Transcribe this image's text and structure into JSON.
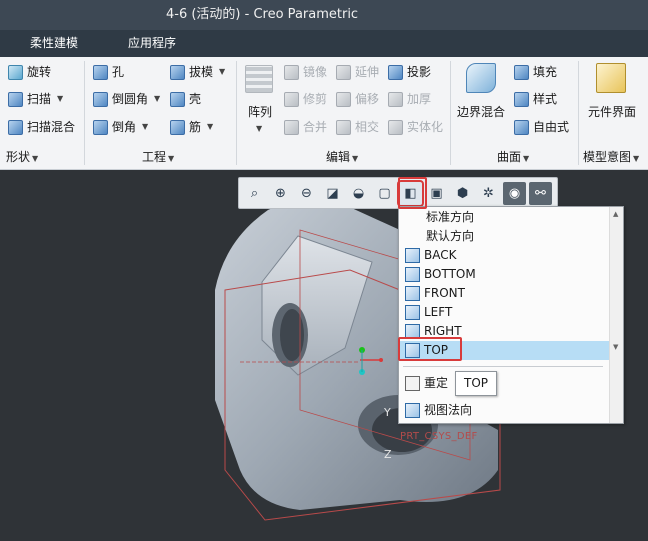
{
  "window": {
    "title": "4-6 (活动的) - Creo Parametric"
  },
  "menu": {
    "tabs": [
      "柔性建模",
      "应用程序"
    ]
  },
  "ribbon": {
    "shape": {
      "items": [
        "旋转",
        "扫描",
        "扫描混合"
      ],
      "label": "形状"
    },
    "engineering": {
      "items": [
        "孔",
        "倒圆角",
        "倒角",
        "拔模",
        "壳",
        "筋"
      ],
      "label": "工程"
    },
    "editing": {
      "array": "阵列",
      "items": [
        "镜像",
        "延伸",
        "投影",
        "修剪",
        "偏移",
        "加厚",
        "合并",
        "相交",
        "实体化"
      ],
      "label": "编辑"
    },
    "surface": {
      "boundary": "边界混合",
      "items": [
        "填充",
        "样式",
        "自由式"
      ],
      "label": "曲面"
    },
    "model_intent": {
      "item": "元件界面",
      "label": "模型意图"
    }
  },
  "view_dropdown": {
    "items": [
      "标准方向",
      "默认方向",
      "BACK",
      "BOTTOM",
      "FRONT",
      "LEFT",
      "RIGHT",
      "TOP"
    ],
    "selected": "TOP",
    "actions": [
      "重定",
      "视图法向"
    ]
  },
  "tooltip": "TOP",
  "viewport": {
    "axis_y": "Y",
    "axis_z": "Z",
    "csys": "PRT_CSYS_DEF"
  }
}
